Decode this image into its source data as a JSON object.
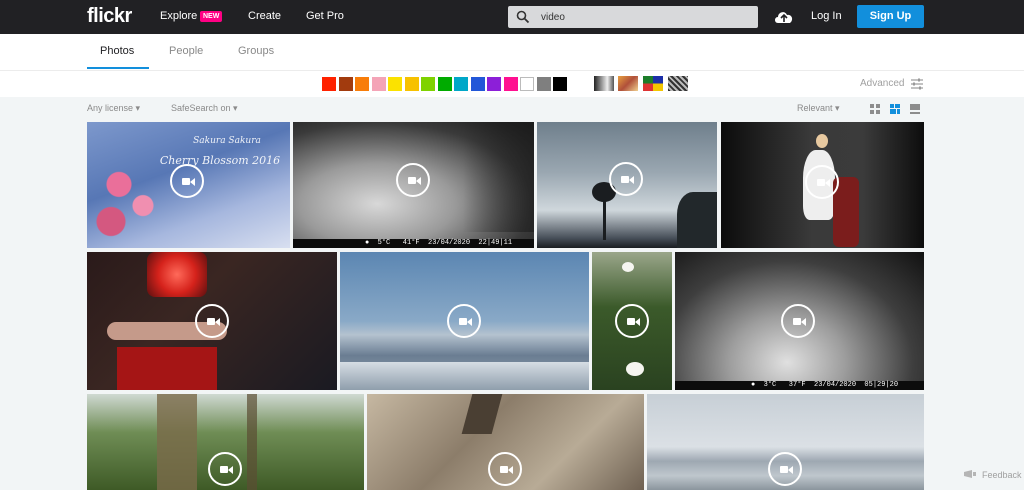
{
  "header": {
    "logo": "flickr",
    "nav": {
      "explore": "Explore",
      "explore_badge": "NEW",
      "create": "Create",
      "get_pro": "Get Pro"
    },
    "search": {
      "value": "video",
      "placeholder": ""
    },
    "login": "Log In",
    "signup": "Sign Up"
  },
  "tabs": {
    "photos": "Photos",
    "people": "People",
    "groups": "Groups"
  },
  "filters": {
    "colors": [
      "#ff2200",
      "#a23b0e",
      "#f87d09",
      "#f4a4b7",
      "#fbe200",
      "#f7c100",
      "#7fd200",
      "#00ab00",
      "#00a7c8",
      "#2257d8",
      "#8c1fd8",
      "#ff1090",
      "#ffffff",
      "#7f7f7f",
      "#000000"
    ],
    "styles": [
      "black-and-white",
      "shallow-depth-of-field",
      "minimalist",
      "patterns"
    ],
    "advanced": "Advanced"
  },
  "secondary": {
    "license": "Any license",
    "safesearch": "SafeSearch on",
    "sort": "Relevant"
  },
  "photos": {
    "p4_stamp": "●  5°C   41°F  23/04/2020  22|49|11",
    "p8_stamp": "●  3°C   37°F  23/04/2020  05|29|20",
    "p1_caption_line1": "Sakura Sakura",
    "p1_caption_line2": "Cherry Blossom 2016"
  },
  "feedback": "Feedback"
}
